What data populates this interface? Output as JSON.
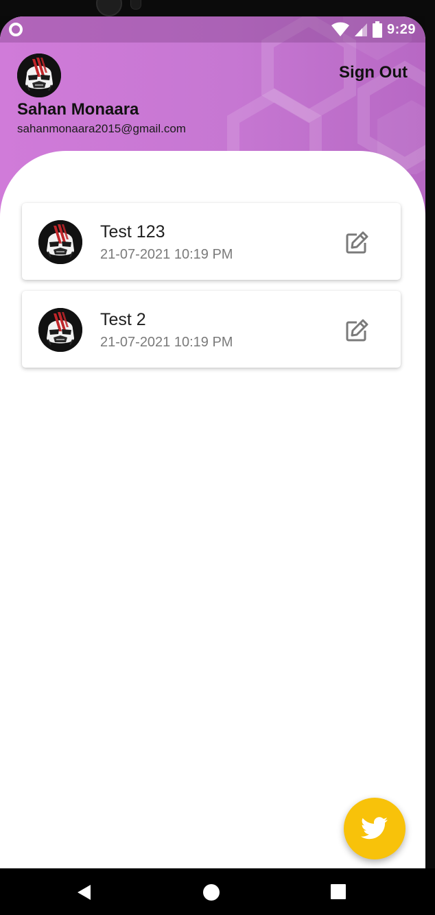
{
  "status_bar": {
    "time": "9:29"
  },
  "profile": {
    "name": "Sahan Monaara",
    "email": "sahanmonaara2015@gmail.com",
    "avatar_icon": "stormtrooper-avatar-icon"
  },
  "header": {
    "sign_out_label": "Sign Out"
  },
  "items": [
    {
      "title": "Test 123",
      "date": "21-07-2021 10:19 PM",
      "edit_icon": "edit-icon"
    },
    {
      "title": "Test 2",
      "date": "21-07-2021 10:19 PM",
      "edit_icon": "edit-icon"
    }
  ],
  "fab": {
    "icon": "twitter-bird-icon",
    "color": "#f8c20a"
  },
  "navigation": [
    "back",
    "home",
    "recents"
  ],
  "colors": {
    "header_start": "#d07bd9",
    "header_end": "#b768c4",
    "fab": "#f8c20a"
  }
}
